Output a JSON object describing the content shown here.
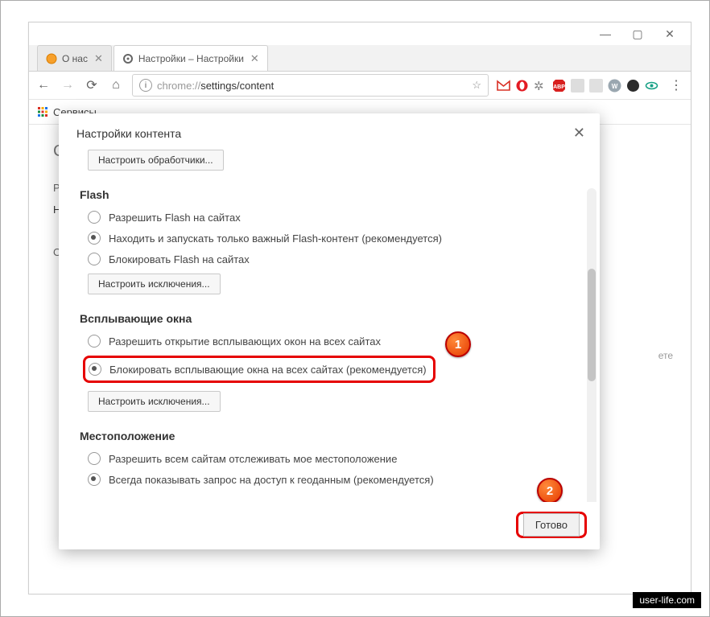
{
  "window": {
    "min": "—",
    "max": "▢",
    "close": "✕"
  },
  "tabs": [
    {
      "title": "О нас"
    },
    {
      "title": "Настройки – Настройки"
    }
  ],
  "url_prefix": "chrome://",
  "url_rest": "settings/content",
  "bookmarks_label": "Сервисы",
  "page": {
    "chrome": "Chrome",
    "nav1": "Расшире",
    "nav2": "Настройк",
    "nav3": "О програ",
    "side_hint": "ете"
  },
  "dialog": {
    "title": "Настройки контента",
    "btn_handlers": "Настроить обработчики...",
    "flash": {
      "title": "Flash",
      "opt1": "Разрешить Flash на сайтах",
      "opt2": "Находить и запускать только важный Flash-контент (рекомендуется)",
      "opt3": "Блокировать Flash на сайтах",
      "btn": "Настроить исключения..."
    },
    "popups": {
      "title": "Всплывающие окна",
      "opt1": "Разрешить открытие всплывающих окон на всех сайтах",
      "opt2": "Блокировать всплывающие окна на всех сайтах (рекомендуется)",
      "btn": "Настроить исключения..."
    },
    "location": {
      "title": "Местоположение",
      "opt1": "Разрешить всем сайтам отслеживать мое местоположение",
      "opt2": "Всегда показывать запрос на доступ к геоданным (рекомендуется)"
    },
    "done": "Готово"
  },
  "badges": {
    "b1": "1",
    "b2": "2"
  },
  "watermark": "user-life.com"
}
